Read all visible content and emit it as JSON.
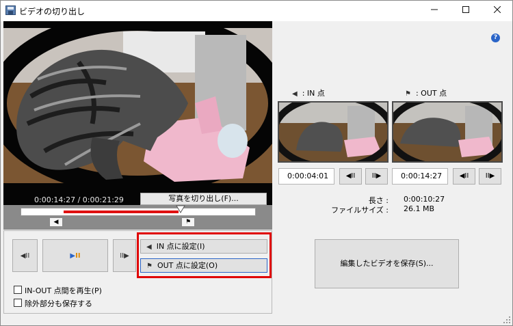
{
  "window": {
    "title": "ビデオの切り出し"
  },
  "player": {
    "time_display": "0:00:14:27 / 0:00:21:29",
    "snapshot_label": "写真を切り出し(F)...",
    "progress_fraction": 0.674
  },
  "controls": {
    "in_point_label": "IN 点に設定(I)",
    "out_point_label": "OUT 点に設定(O)",
    "play_inout_label": "IN-OUT 点間を再生(P)",
    "save_excluded_label": "除外部分も保存する"
  },
  "right": {
    "in_header": ": IN 点",
    "out_header": ": OUT 点",
    "in_time": "0:00:04:01",
    "out_time": "0:00:14:27",
    "length_label": "長さ :",
    "length_value": "0:00:10:27",
    "filesize_label": "ファイルサイズ :",
    "filesize_value": "26.1 MB",
    "save_button_label": "編集したビデオを保存(S)..."
  },
  "icons": {
    "app": "film-save-icon",
    "help": "help-icon"
  }
}
